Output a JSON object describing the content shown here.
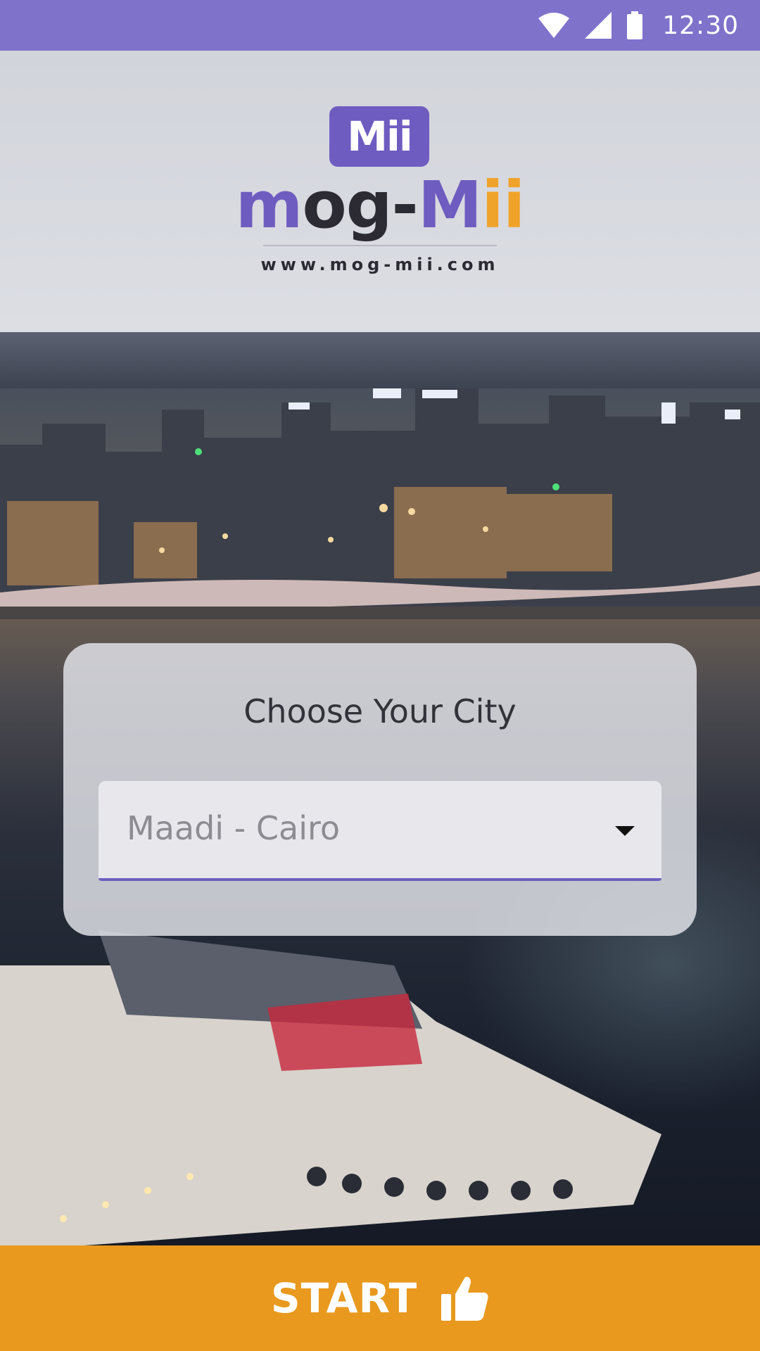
{
  "status_bar": {
    "time": "12:30",
    "icons": [
      "wifi-icon",
      "cell-signal-icon",
      "battery-icon"
    ],
    "background": "#7f72cb"
  },
  "brand": {
    "badge_text": "Mii",
    "wordmark_parts": [
      "m",
      "og-",
      "M",
      "ii"
    ],
    "website": "www.mog-mii.com",
    "colors": {
      "purple": "#6f5cc0",
      "dark": "#2c2a33",
      "orange": "#f0a32a"
    }
  },
  "city_card": {
    "title": "Choose Your City",
    "selected_city": "Maadi - Cairo",
    "dropdown_icon": "caret-down-icon"
  },
  "start_button": {
    "label": "START",
    "icon": "thumbs-up-icon",
    "background": "#e8991e"
  },
  "background_image": {
    "icon": "night-city-river-photo"
  }
}
